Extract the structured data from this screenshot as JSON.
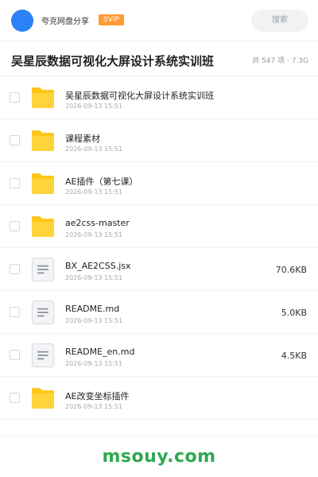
{
  "header": {
    "user_name": "夸克网盘分享",
    "badge": "SVIP",
    "search_placeholder": "搜索"
  },
  "title_bar": {
    "title": "吴星辰数据可视化大屏设计系统实训班",
    "meta": "共 547 项 · 7.3G"
  },
  "files": [
    {
      "icon": "folder-icon",
      "name": "吴星辰数据可视化大屏设计系统实训班",
      "date": "2026-09-13 15:51",
      "size": ""
    },
    {
      "icon": "folder-icon",
      "name": "课程素材",
      "date": "2026-09-13 15:51",
      "size": ""
    },
    {
      "icon": "folder-icon",
      "name": "AE插件（第七课）",
      "date": "2026-09-13 15:51",
      "size": ""
    },
    {
      "icon": "folder-icon",
      "name": "ae2css-master",
      "date": "2026-09-13 15:51",
      "size": ""
    },
    {
      "icon": "document-icon",
      "name": "BX_AE2CSS.jsx",
      "date": "2026-09-13 15:51",
      "size": "70.6KB"
    },
    {
      "icon": "document-icon",
      "name": "README.md",
      "date": "2026-09-13 15:51",
      "size": "5.0KB"
    },
    {
      "icon": "document-icon",
      "name": "README_en.md",
      "date": "2026-09-13 15:51",
      "size": "4.5KB"
    },
    {
      "icon": "folder-icon",
      "name": "AE改变坐标插件",
      "date": "2026-09-13 15:51",
      "size": ""
    }
  ],
  "watermark": "msouy.com",
  "colors": {
    "accent": "#2b82f6",
    "badge": "#ff9b36",
    "folder": "#ffc61a",
    "watermark": "#2fa84f"
  }
}
